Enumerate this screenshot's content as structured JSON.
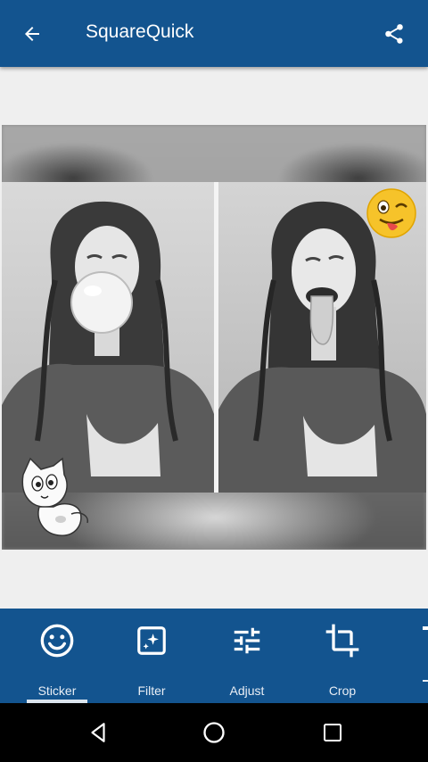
{
  "app_bar": {
    "title": "SquareQuick",
    "back_icon": "arrow-back-icon",
    "share_icon": "share-icon",
    "color": "#13548f"
  },
  "collage": {
    "layout": "two-photo side by side on blurred background",
    "left_photo": "black-and-white photo of a woman blowing a bubble gum bubble",
    "right_photo": "black-and-white photo of a woman sticking out her tongue",
    "stickers": [
      "winking-tongue-emoji-sticker",
      "cartoon-cat-sticker"
    ]
  },
  "toolbar": {
    "tools": [
      {
        "label": "Sticker",
        "icon": "smiley-icon",
        "selected": true
      },
      {
        "label": "Filter",
        "icon": "filter-sparkle-icon",
        "selected": false
      },
      {
        "label": "Adjust",
        "icon": "sliders-icon",
        "selected": false
      },
      {
        "label": "Crop",
        "icon": "crop-icon",
        "selected": false
      }
    ]
  },
  "nav_bar": {
    "back": "nav-back-icon",
    "home": "nav-home-icon",
    "recents": "nav-recents-icon"
  }
}
